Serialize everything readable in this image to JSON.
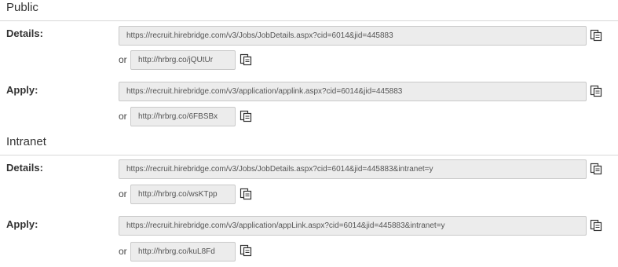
{
  "sections": [
    {
      "title": "Public",
      "rows": [
        {
          "label": "Details:",
          "url": "https://recruit.hirebridge.com/v3/Jobs/JobDetails.aspx?cid=6014&jid=445883",
          "or": "or",
          "short_url": "http://hrbrg.co/jQUtUr"
        },
        {
          "label": "Apply:",
          "url": "https://recruit.hirebridge.com/v3/application/applink.aspx?cid=6014&jid=445883",
          "or": "or",
          "short_url": "http://hrbrg.co/6FBSBx"
        }
      ]
    },
    {
      "title": "Intranet",
      "rows": [
        {
          "label": "Details:",
          "url": "https://recruit.hirebridge.com/v3/Jobs/JobDetails.aspx?cid=6014&jid=445883&intranet=y",
          "or": "or",
          "short_url": "http://hrbrg.co/wsKTpp"
        },
        {
          "label": "Apply:",
          "url": "https://recruit.hirebridge.com/v3/application/appLink.aspx?cid=6014&jid=445883&intranet=y",
          "or": "or",
          "short_url": "http://hrbrg.co/kuL8Fd"
        }
      ]
    }
  ],
  "icons": {
    "copy": "copy-to-clipboard-icon"
  }
}
